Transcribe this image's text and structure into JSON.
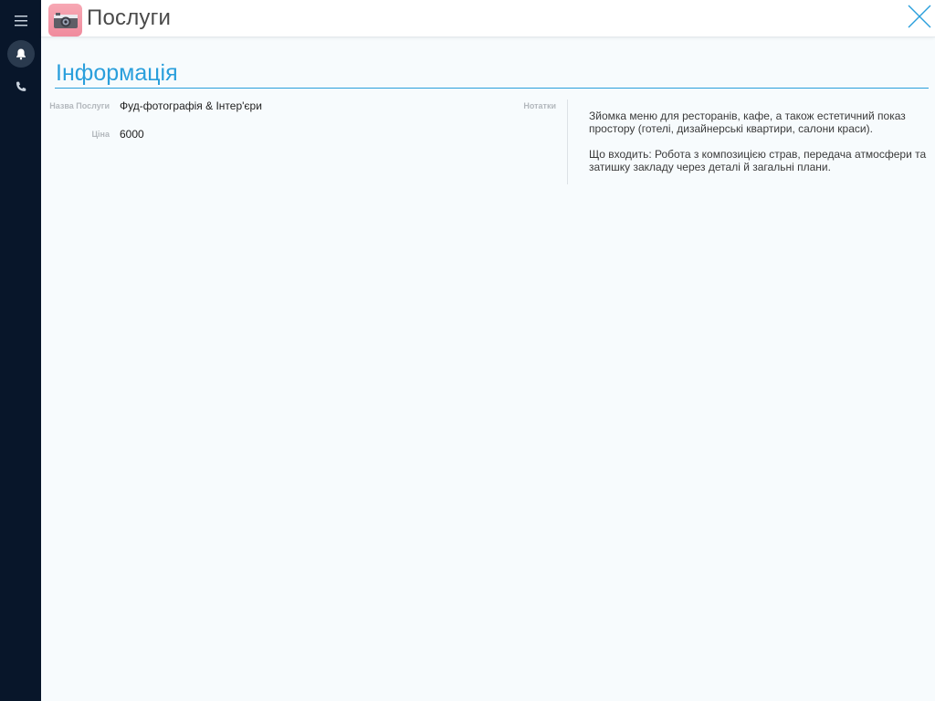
{
  "header": {
    "title": "Послуги",
    "app_icon": "camera-icon"
  },
  "sidebar": {
    "items": [
      {
        "icon": "menu-icon"
      },
      {
        "icon": "bell-icon"
      },
      {
        "icon": "phone-icon"
      }
    ]
  },
  "section": {
    "title": "Інформація"
  },
  "fields": {
    "name_label": "Назва Послуги",
    "name_value": "Фуд-фотографія & Інтер'єри",
    "price_label": "Ціна",
    "price_value": "6000",
    "notes_label": "Нотатки"
  },
  "notes": {
    "paragraph1": "Зйомка меню для ресторанів, кафе, а також естетичний показ простору (готелі, дизайнерські квартири, салони краси).",
    "paragraph2": "Що входить: Робота з композицією страв, передача атмосфери та затишку закладу через деталі й загальні плани."
  },
  "colors": {
    "sidebar": "#08162a",
    "accent": "#2a9fdc",
    "background": "#f7fbfd",
    "app_icon": "#f08b9d"
  }
}
